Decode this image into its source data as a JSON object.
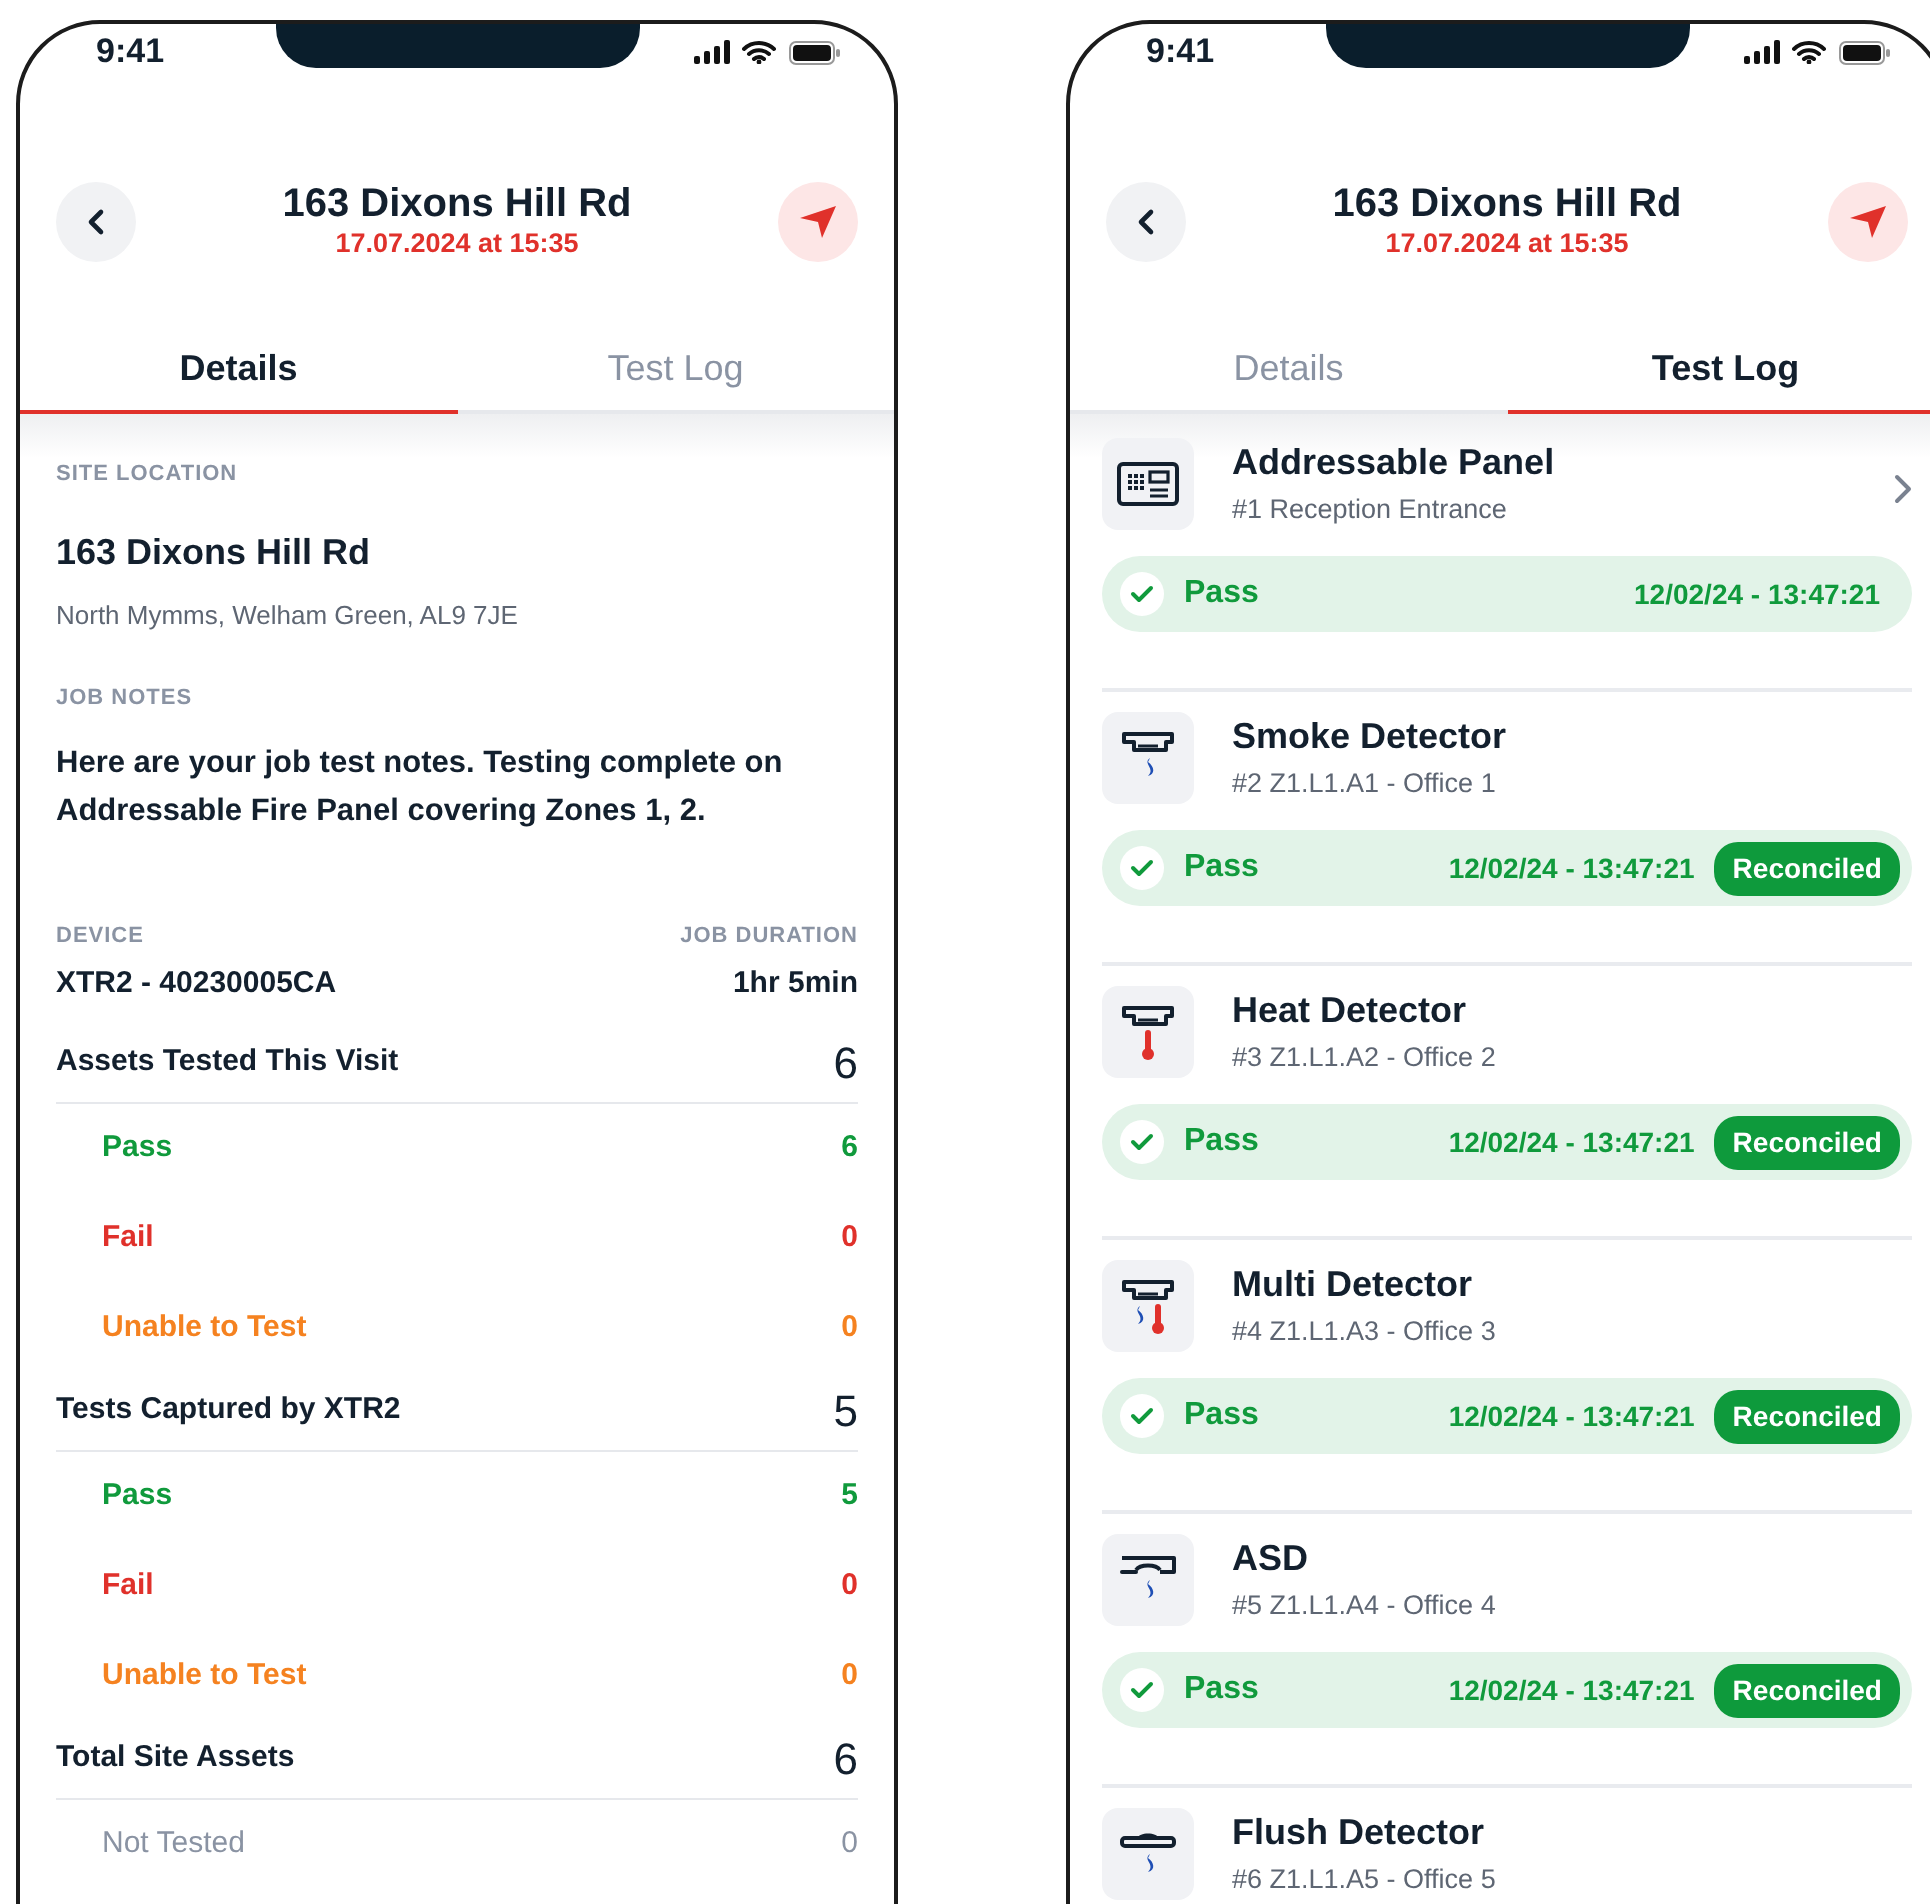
{
  "screens": [
    {
      "status_bar": {
        "time": "9:41"
      },
      "header": {
        "title": "163 Dixons Hill Rd",
        "subtitle": "17.07.2024 at 15:35"
      },
      "tabs": [
        {
          "label": "Details",
          "selected": true
        },
        {
          "label": "Test Log",
          "selected": false
        }
      ],
      "details": {
        "site_location": {
          "label": "SITE LOCATION",
          "name": "163 Dixons Hill Rd",
          "address": "North Mymms, Welham Green,  AL9 7JE"
        },
        "job_notes": {
          "label": "JOB NOTES",
          "text": "Here are your job test notes. Testing complete on Addressable Fire Panel covering Zones 1, 2."
        },
        "device": {
          "label": "DEVICE",
          "value": "XTR2 - 40230005CA"
        },
        "job_duration": {
          "label": "JOB DURATION",
          "value": "1hr 5min"
        },
        "groups": [
          {
            "label": "Assets Tested This Visit",
            "value": "6",
            "rows": [
              {
                "kind": "pass",
                "label": "Pass",
                "value": "6"
              },
              {
                "kind": "fail",
                "label": "Fail",
                "value": "0"
              },
              {
                "kind": "unable",
                "label": "Unable to Test",
                "value": "0"
              }
            ]
          },
          {
            "label": "Tests Captured by XTR2",
            "value": "5",
            "rows": [
              {
                "kind": "pass",
                "label": "Pass",
                "value": "5"
              },
              {
                "kind": "fail",
                "label": "Fail",
                "value": "0"
              },
              {
                "kind": "unable",
                "label": "Unable to Test",
                "value": "0"
              }
            ]
          },
          {
            "label": "Total Site Assets",
            "value": "6",
            "rows": [
              {
                "kind": "untested",
                "label": "Not Tested",
                "value": "0"
              }
            ]
          }
        ]
      }
    },
    {
      "status_bar": {
        "time": "9:41"
      },
      "header": {
        "title": "163 Dixons Hill Rd",
        "subtitle": "17.07.2024 at 15:35"
      },
      "tabs": [
        {
          "label": "Details",
          "selected": false
        },
        {
          "label": "Test Log",
          "selected": true
        }
      ],
      "test_log": [
        {
          "kind": "panel",
          "name": "Addressable Panel",
          "location": "#1 Reception Entrance",
          "chevron": true,
          "result": {
            "kind": "pass",
            "label": "Pass",
            "time": "12/02/24 - 13:47:21"
          }
        },
        {
          "kind": "smoke",
          "name": "Smoke Detector",
          "location": "#2 Z1.L1.A1 - Office 1",
          "chevron": false,
          "result": {
            "kind": "pass",
            "label": "Pass",
            "time": "12/02/24 - 13:47:21",
            "badge": "Reconciled"
          }
        },
        {
          "kind": "heat",
          "name": "Heat Detector",
          "location": "#3 Z1.L1.A2 - Office 2",
          "chevron": false,
          "result": {
            "kind": "pass",
            "label": "Pass",
            "time": "12/02/24 - 13:47:21",
            "badge": "Reconciled"
          }
        },
        {
          "kind": "multi",
          "name": "Multi Detector",
          "location": "#4 Z1.L1.A3 - Office 3",
          "chevron": false,
          "result": {
            "kind": "pass",
            "label": "Pass",
            "time": "12/02/24 - 13:47:21",
            "badge": "Reconciled"
          }
        },
        {
          "kind": "asd",
          "name": "ASD",
          "location": "#5 Z1.L1.A4 - Office 4",
          "chevron": false,
          "result": {
            "kind": "pass",
            "label": "Pass",
            "time": "12/02/24 - 13:47:21",
            "badge": "Reconciled"
          }
        },
        {
          "kind": "flush",
          "name": "Flush Detector",
          "location": "#6 Z1.L1.A5 - Office 5",
          "chevron": false
        }
      ]
    }
  ]
}
